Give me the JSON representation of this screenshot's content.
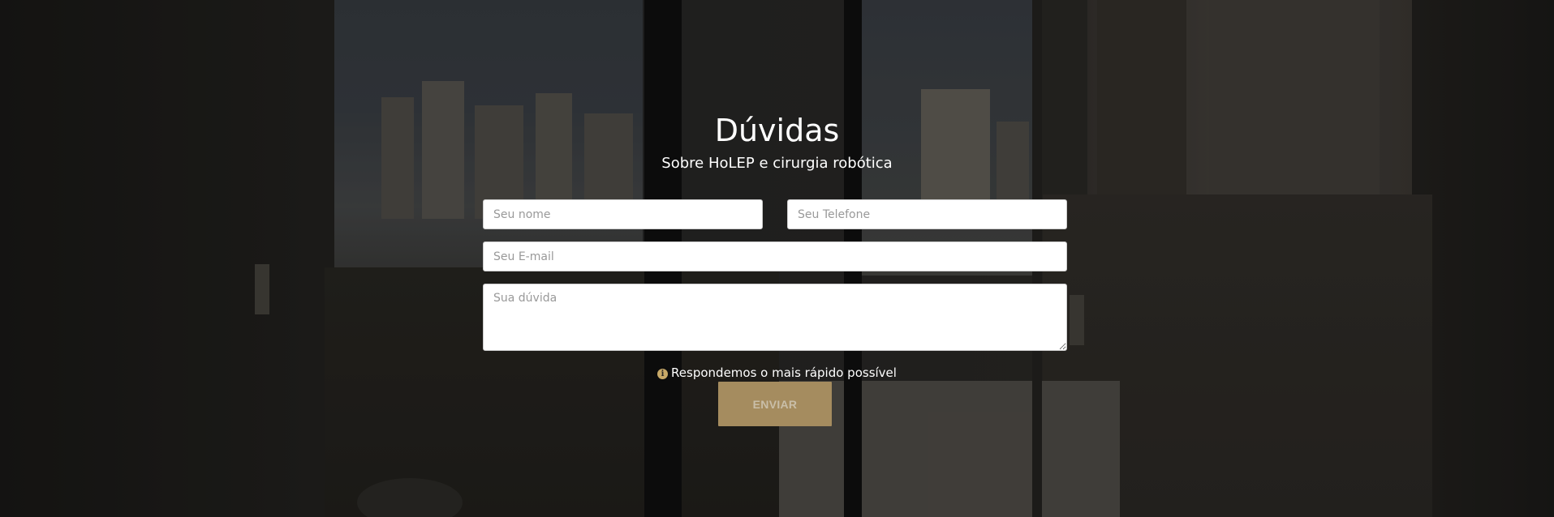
{
  "header": {
    "title": "Dúvidas",
    "subtitle": "Sobre HoLEP e cirurgia robótica"
  },
  "form": {
    "name_placeholder": "Seu nome",
    "phone_placeholder": "Seu Telefone",
    "email_placeholder": "Seu E-mail",
    "message_placeholder": "Sua dúvida",
    "note_icon": "info-icon",
    "note_text": "Respondemos o mais rápido possível",
    "submit_label": "ENVIAR"
  },
  "colors": {
    "accent": "#a58c5f",
    "icon": "#c8a968"
  }
}
